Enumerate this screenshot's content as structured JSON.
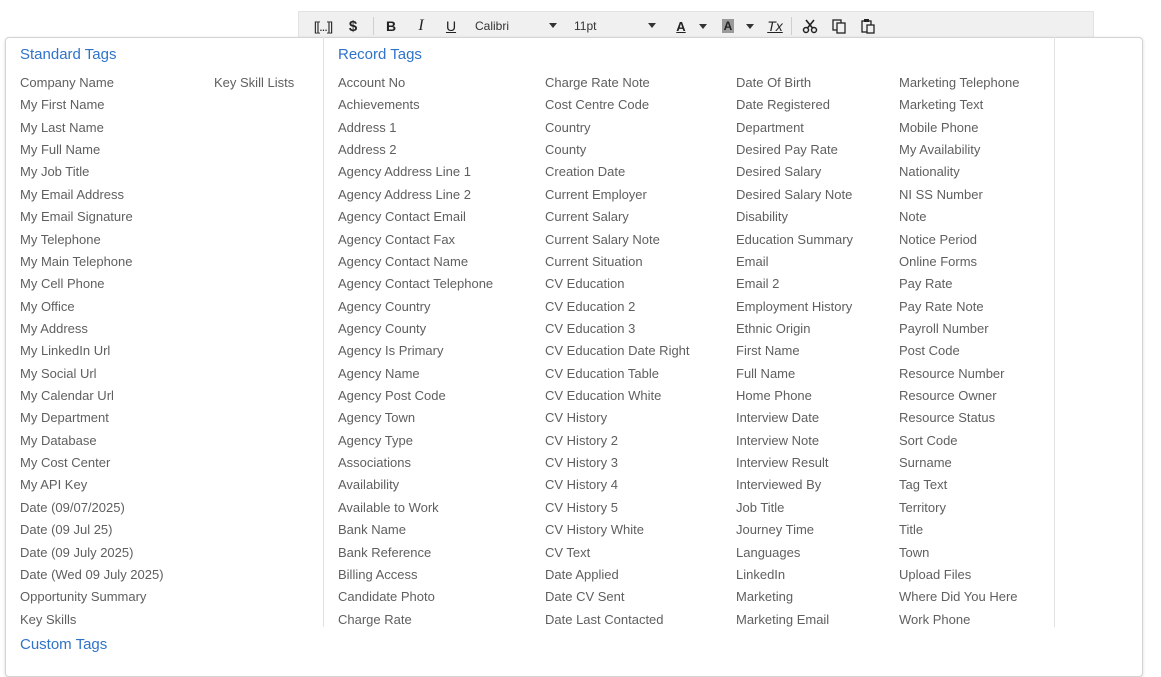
{
  "toolbar": {
    "placeholder_label": "[[...]]",
    "dollar_label": "$",
    "bold_label": "B",
    "italic_label": "I",
    "underline_label": "U",
    "font_family_value": "Calibri",
    "font_size_value": "11pt",
    "text_color_label": "A",
    "bg_color_label": "A",
    "clear_format_label": "Tx"
  },
  "standard_tags": {
    "heading": "Standard Tags",
    "key_skill_lists": "Key Skill Lists",
    "items": [
      "Company Name",
      "My First Name",
      "My Last Name",
      "My Full Name",
      "My Job Title",
      "My Email Address",
      "My Email Signature",
      "My Telephone",
      "My Main Telephone",
      "My Cell Phone",
      "My Office",
      "My Address",
      "My LinkedIn Url",
      "My Social Url",
      "My Calendar Url",
      "My Department",
      "My Database",
      "My Cost Center",
      "My API Key",
      "Date (09/07/2025)",
      "Date (09 Jul 25)",
      "Date (09 July 2025)",
      "Date (Wed 09 July 2025)",
      "Opportunity Summary",
      "Key Skills"
    ]
  },
  "record_tags": {
    "heading": "Record Tags",
    "col1": [
      "Account No",
      "Achievements",
      "Address 1",
      "Address 2",
      "Agency Address Line 1",
      "Agency Address Line 2",
      "Agency Contact Email",
      "Agency Contact Fax",
      "Agency Contact Name",
      "Agency Contact Telephone",
      "Agency Country",
      "Agency County",
      "Agency Is Primary",
      "Agency Name",
      "Agency Post Code",
      "Agency Town",
      "Agency Type",
      "Associations",
      "Availability",
      "Available to Work",
      "Bank Name",
      "Bank Reference",
      "Billing Access",
      "Candidate Photo",
      "Charge Rate"
    ],
    "col2": [
      "Charge Rate Note",
      "Cost Centre Code",
      "Country",
      "County",
      "Creation Date",
      "Current Employer",
      "Current Salary",
      "Current Salary Note",
      "Current Situation",
      "CV Education",
      "CV Education 2",
      "CV Education 3",
      "CV Education Date Right",
      "CV Education Table",
      "CV Education White",
      "CV History",
      "CV History 2",
      "CV History 3",
      "CV History 4",
      "CV History 5",
      "CV History White",
      "CV Text",
      "Date Applied",
      "Date CV Sent",
      "Date Last Contacted"
    ],
    "col3": [
      "Date Of Birth",
      "Date Registered",
      "Department",
      "Desired Pay Rate",
      "Desired Salary",
      "Desired Salary Note",
      "Disability",
      "Education Summary",
      "Email",
      "Email 2",
      "Employment History",
      "Ethnic Origin",
      "First Name",
      "Full Name",
      "Home Phone",
      "Interview Date",
      "Interview Note",
      "Interview Result",
      "Interviewed By",
      "Job Title",
      "Journey Time",
      "Languages",
      "LinkedIn",
      "Marketing",
      "Marketing Email"
    ],
    "col4": [
      "Marketing Telephone",
      "Marketing Text",
      "Mobile Phone",
      "My Availability",
      "Nationality",
      "NI SS Number",
      "Note",
      "Notice Period",
      "Online Forms",
      "Pay Rate",
      "Pay Rate Note",
      "Payroll Number",
      "Post Code",
      "Resource Number",
      "Resource Owner",
      "Resource Status",
      "Sort Code",
      "Surname",
      "Tag Text",
      "Territory",
      "Title",
      "Town",
      "Upload Files",
      "Where Did You Here",
      "Work Phone"
    ]
  },
  "custom_tags": {
    "heading": "Custom Tags"
  },
  "colors": {
    "heading": "#2f73c9",
    "text": "#5f5f5f",
    "toolbar_bg": "#f0f0f0"
  }
}
